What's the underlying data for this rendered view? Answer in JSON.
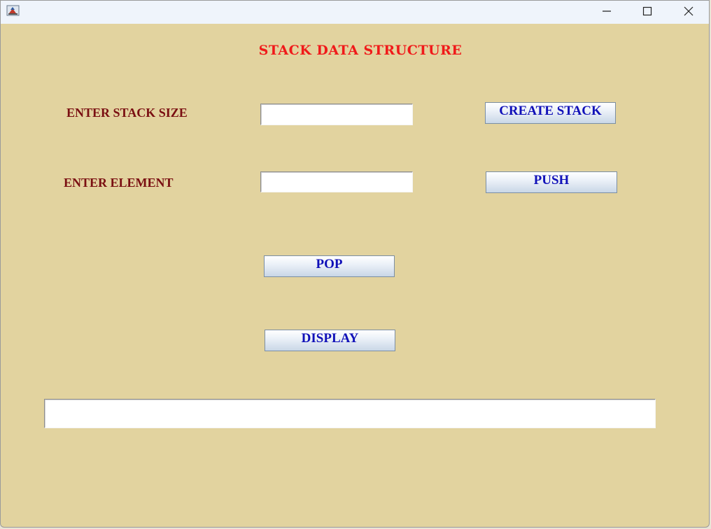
{
  "window": {
    "icon": "java-app-icon",
    "controls": {
      "minimize": "minimize-icon",
      "maximize": "maximize-icon",
      "close": "close-icon"
    }
  },
  "form": {
    "heading": "STACK DATA STRUCTURE",
    "stack_size_label": "ENTER STACK SIZE",
    "stack_size_value": "",
    "element_label": "ENTER ELEMENT",
    "element_value": "",
    "output_value": ""
  },
  "buttons": {
    "create_stack": "CREATE STACK",
    "push": "PUSH",
    "pop": "POP",
    "display": "DISPLAY"
  },
  "colors": {
    "background": "#e2d39f",
    "heading": "#f01a1a",
    "label": "#7a0f12",
    "button_text": "#1010b8"
  }
}
